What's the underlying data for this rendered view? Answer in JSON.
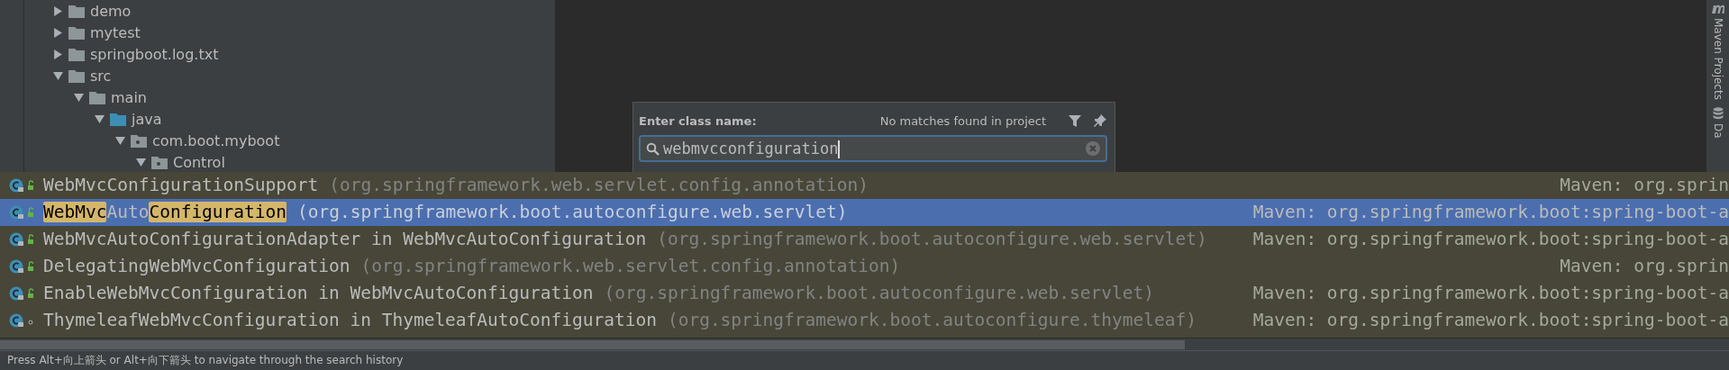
{
  "project_tree": [
    {
      "label": "demo",
      "kind": "folder",
      "expanded": false
    },
    {
      "label": "mytest",
      "kind": "folder",
      "expanded": false
    },
    {
      "label": "springboot.log.txt",
      "kind": "folder",
      "expanded": false
    },
    {
      "label": "src",
      "kind": "folder",
      "expanded": true,
      "children": [
        {
          "label": "main",
          "kind": "folder",
          "expanded": true,
          "children": [
            {
              "label": "java",
              "kind": "source",
              "expanded": true,
              "children": [
                {
                  "label": "com.boot.myboot",
                  "kind": "package",
                  "expanded": true,
                  "children": [
                    {
                      "label": "Control",
                      "kind": "package",
                      "expanded": true
                    }
                  ]
                }
              ]
            }
          ]
        }
      ]
    }
  ],
  "side_strip": {
    "tabs": [
      {
        "label": "Maven Projects",
        "kind": "maven"
      },
      {
        "label": "Da",
        "kind": "database"
      }
    ]
  },
  "class_popup": {
    "label": "Enter class name:",
    "status": "No matches found in project",
    "filter_on": false,
    "search": {
      "value": "webmvcconfiguration"
    }
  },
  "results": [
    {
      "selected": false,
      "kind": "public",
      "name": [
        {
          "text": "WebMvcConfigurationSupport",
          "match": false
        }
      ],
      "package": "(org.springframework.web.servlet.config.annotation)",
      "location": "Maven: org.sprin"
    },
    {
      "selected": true,
      "kind": "public",
      "name": [
        {
          "text": "WebMvc",
          "match": true
        },
        {
          "text": "Auto",
          "match": false
        },
        {
          "text": "Configuration",
          "match": true
        }
      ],
      "package": "(org.springframework.boot.autoconfigure.web.servlet)",
      "location": "Maven: org.springframework.boot:spring-boot-a"
    },
    {
      "selected": false,
      "kind": "public",
      "name": [
        {
          "text": "WebMvcAutoConfigurationAdapter in WebMvcAutoConfiguration",
          "match": false
        }
      ],
      "package": "(org.springframework.boot.autoconfigure.web.servlet)",
      "location": "Maven: org.springframework.boot:spring-boot-a"
    },
    {
      "selected": false,
      "kind": "public",
      "name": [
        {
          "text": "DelegatingWebMvcConfiguration",
          "match": false
        }
      ],
      "package": "(org.springframework.web.servlet.config.annotation)",
      "location": "Maven: org.sprin"
    },
    {
      "selected": false,
      "kind": "public",
      "name": [
        {
          "text": "EnableWebMvcConfiguration in WebMvcAutoConfiguration",
          "match": false
        }
      ],
      "package": "(org.springframework.boot.autoconfigure.web.servlet)",
      "location": "Maven: org.springframework.boot:spring-boot-a"
    },
    {
      "selected": false,
      "kind": "package",
      "name": [
        {
          "text": "ThymeleafWebMvcConfiguration in ThymeleafAutoConfiguration",
          "match": false
        }
      ],
      "package": "(org.springframework.boot.autoconfigure.thymeleaf)",
      "location": "Maven: org.springframework.boot:spring-boot-a"
    }
  ],
  "status_bar": "Press Alt+向上箭头 or Alt+向下箭头 to navigate through the search history"
}
